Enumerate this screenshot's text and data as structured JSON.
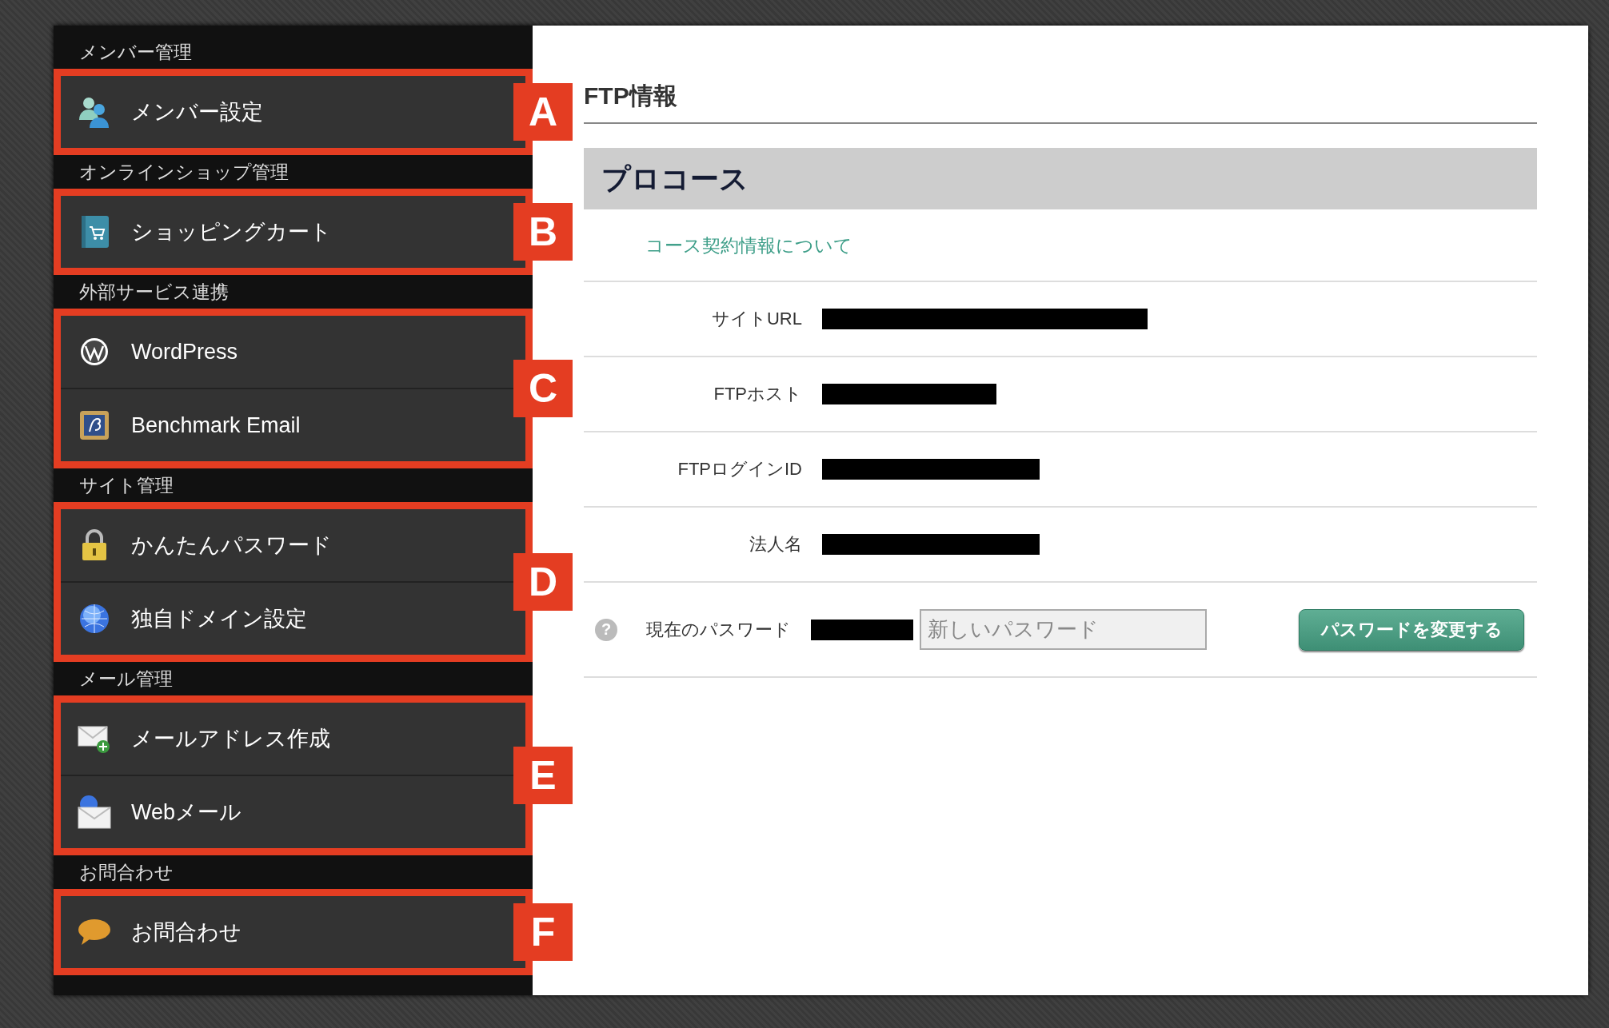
{
  "sidebar": {
    "sections": [
      {
        "heading": "メンバー管理",
        "marker": "A",
        "items": [
          {
            "label": "メンバー設定",
            "kind": "members"
          }
        ]
      },
      {
        "heading": "オンラインショップ管理",
        "marker": "B",
        "items": [
          {
            "label": "ショッピングカート",
            "kind": "cart"
          }
        ]
      },
      {
        "heading": "外部サービス連携",
        "marker": "C",
        "items": [
          {
            "label": "WordPress",
            "kind": "wordpress"
          },
          {
            "label": "Benchmark Email",
            "kind": "benchmark"
          }
        ]
      },
      {
        "heading": "サイト管理",
        "marker": "D",
        "items": [
          {
            "label": "かんたんパスワード",
            "kind": "lock"
          },
          {
            "label": "独自ドメイン設定",
            "kind": "globe"
          }
        ]
      },
      {
        "heading": "メール管理",
        "marker": "E",
        "items": [
          {
            "label": "メールアドレス作成",
            "kind": "mailadd"
          },
          {
            "label": "Webメール",
            "kind": "webmail"
          }
        ]
      },
      {
        "heading": "お問合わせ",
        "marker": "F",
        "items": [
          {
            "label": "お問合わせ",
            "kind": "bubble"
          }
        ]
      }
    ]
  },
  "content": {
    "title": "FTP情報",
    "plan": "プロコース",
    "link": "コース契約情報について",
    "rows": [
      {
        "label": "サイトURL",
        "redacted": true
      },
      {
        "label": "FTPホスト",
        "redacted": true
      },
      {
        "label": "FTPログインID",
        "redacted": true
      },
      {
        "label": "法人名",
        "redacted": true
      }
    ],
    "password": {
      "help": "?",
      "label": "現在のパスワード",
      "redacted": true,
      "placeholder": "新しいパスワード",
      "button": "パスワードを変更する"
    }
  }
}
